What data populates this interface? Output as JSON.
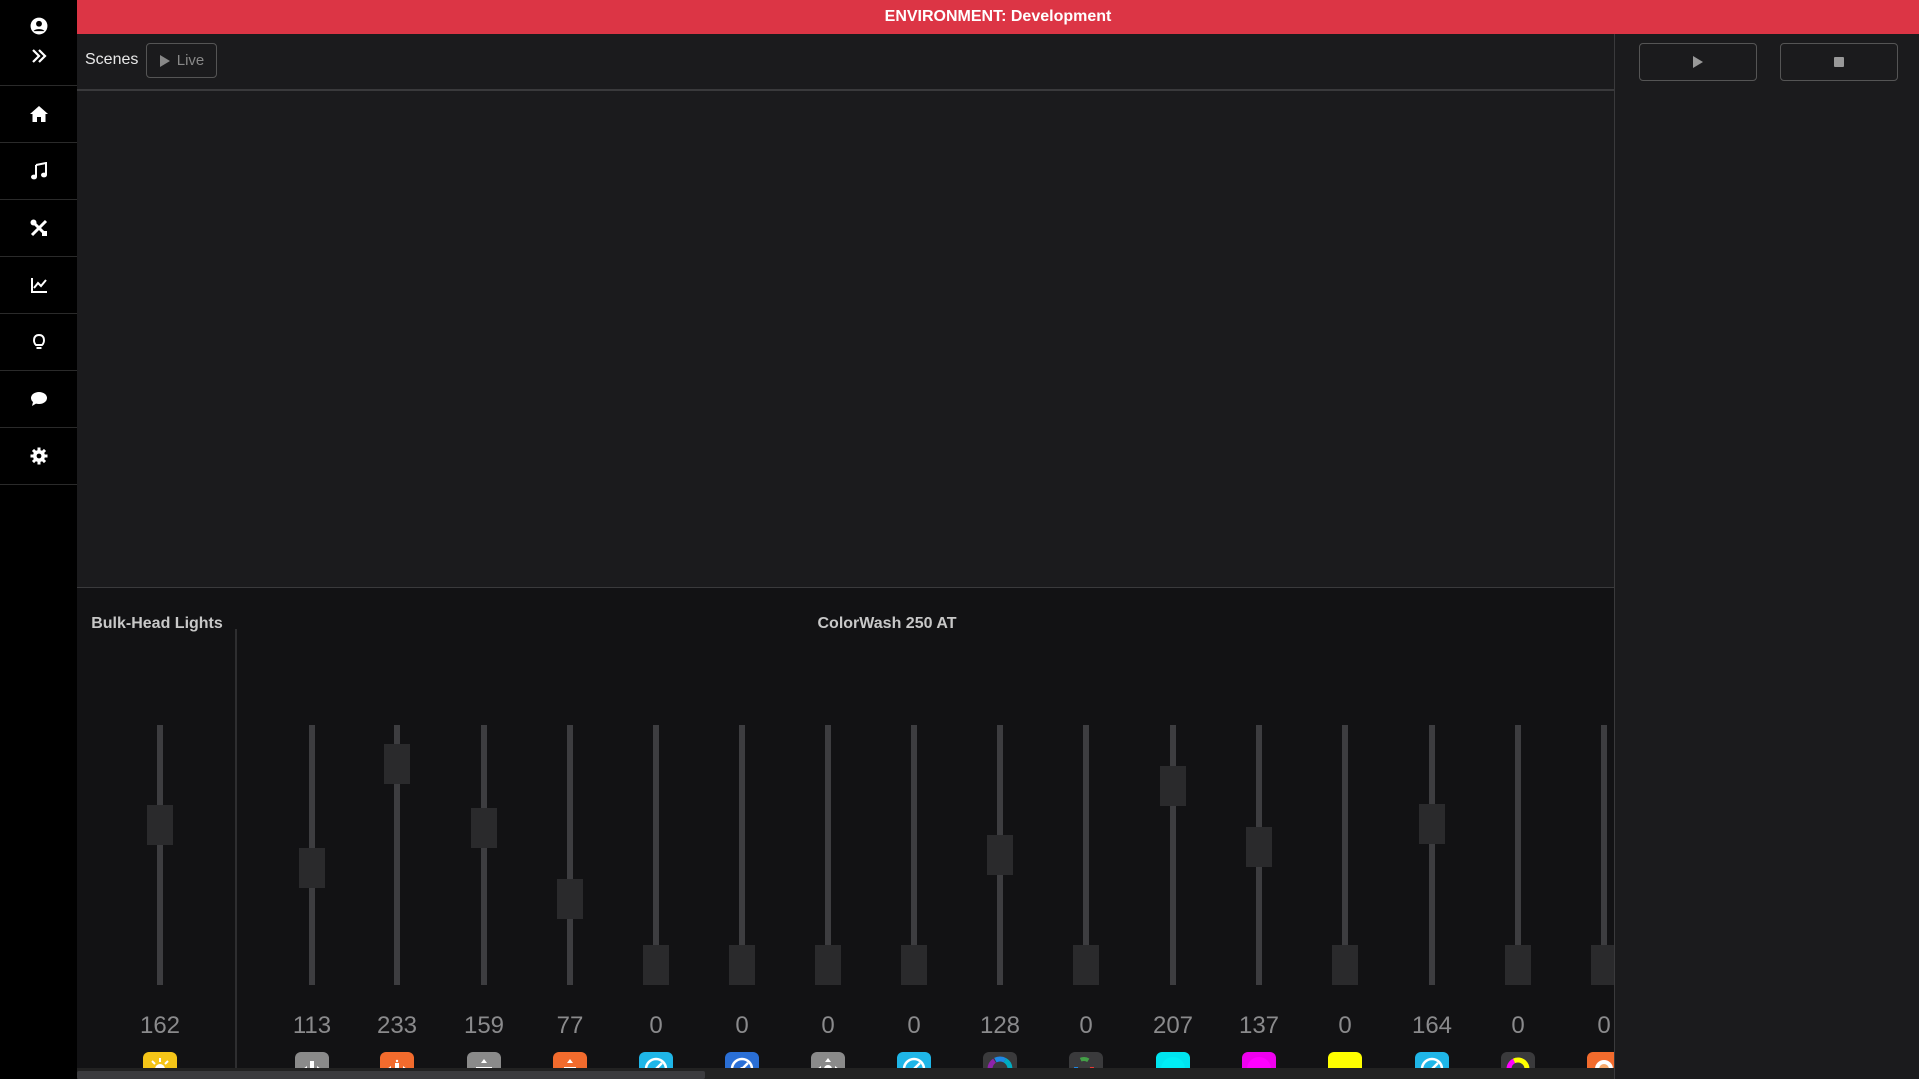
{
  "environment": {
    "text": "ENVIRONMENT: Development",
    "color": "#dc3545"
  },
  "sidebar": {
    "top_icons": [
      "user-circle-icon",
      "double-chevron-right-icon"
    ],
    "items": [
      {
        "name": "home",
        "icon": "home-icon"
      },
      {
        "name": "music",
        "icon": "music-note-icon"
      },
      {
        "name": "tools",
        "icon": "tools-icon"
      },
      {
        "name": "analytics",
        "icon": "chart-line-icon"
      },
      {
        "name": "lights",
        "icon": "lightbulb-icon"
      },
      {
        "name": "chat",
        "icon": "comment-icon"
      },
      {
        "name": "settings",
        "icon": "gear-icon"
      }
    ]
  },
  "toolbar": {
    "scenes_label": "Scenes",
    "live_label": "Live"
  },
  "right_panel": {
    "play_icon": "play-icon",
    "stop_icon": "stop-icon"
  },
  "groups": [
    {
      "title": "Bulk-Head Lights"
    },
    {
      "title": "ColorWash 250 AT"
    }
  ],
  "channels": [
    {
      "group": 0,
      "value": 162,
      "icon": "brightness-icon",
      "icon_bg": "#f5c518"
    },
    {
      "group": 1,
      "value": 113,
      "icon": "pan-icon",
      "icon_bg": "#8a8a8a"
    },
    {
      "group": 1,
      "value": 233,
      "icon": "pan-fine-icon",
      "icon_bg": "#f26b2d"
    },
    {
      "group": 1,
      "value": 159,
      "icon": "tilt-icon",
      "icon_bg": "#8a8a8a"
    },
    {
      "group": 1,
      "value": 77,
      "icon": "tilt-fine-icon",
      "icon_bg": "#f26b2d"
    },
    {
      "group": 1,
      "value": 0,
      "icon": "speed-icon",
      "icon_bg": "#1fb6e8"
    },
    {
      "group": 1,
      "value": 0,
      "icon": "speed-fine-icon",
      "icon_bg": "#2a6fd6"
    },
    {
      "group": 1,
      "value": 0,
      "icon": "position-icon",
      "icon_bg": "#8a8a8a"
    },
    {
      "group": 1,
      "value": 0,
      "icon": "speed-icon",
      "icon_bg": "#1fb6e8"
    },
    {
      "group": 1,
      "value": 128,
      "icon": "color-wheel-icon",
      "icon_bg": "#3a3a3c"
    },
    {
      "group": 1,
      "value": 0,
      "icon": "color-wheel-fine-icon",
      "icon_bg": "#3a3a3c"
    },
    {
      "group": 1,
      "value": 207,
      "icon": "cyan-icon",
      "icon_bg": "#00e5f0"
    },
    {
      "group": 1,
      "value": 137,
      "icon": "magenta-icon",
      "icon_bg": "#ee00ee"
    },
    {
      "group": 1,
      "value": 0,
      "icon": "yellow-icon",
      "icon_bg": "#ffff00"
    },
    {
      "group": 1,
      "value": 164,
      "icon": "speed-icon",
      "icon_bg": "#1fb6e8"
    },
    {
      "group": 1,
      "value": 0,
      "icon": "cmy-icon",
      "icon_bg": "#3a3a3c"
    },
    {
      "group": 1,
      "value": 0,
      "icon": "gobo-icon",
      "icon_bg": "#f26b2d"
    }
  ]
}
